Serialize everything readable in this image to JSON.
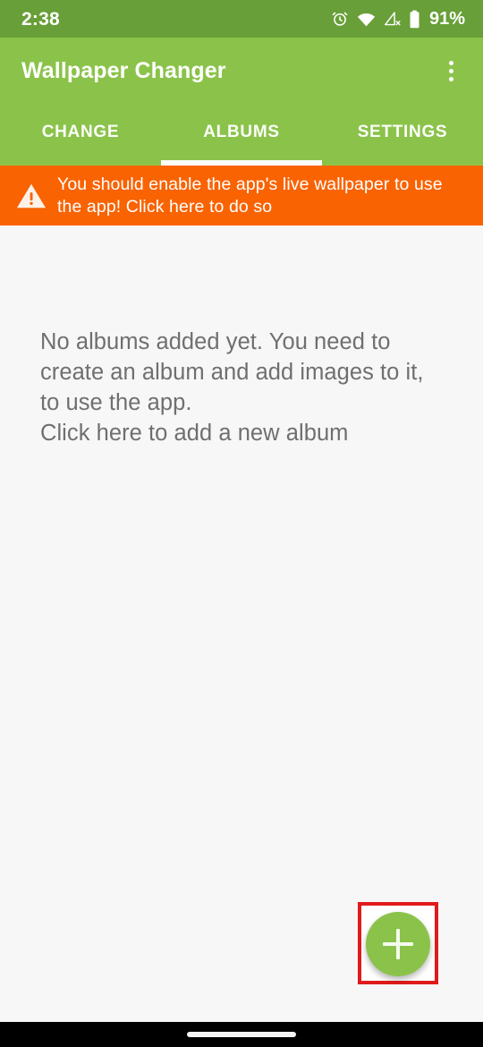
{
  "status_bar": {
    "time": "2:38",
    "battery_percent": "91%",
    "icons": [
      "alarm-icon",
      "wifi-icon",
      "no-sim-signal-icon",
      "battery-icon"
    ],
    "background_color": "#689f38"
  },
  "app_bar": {
    "title": "Wallpaper Changer",
    "overflow_label": "More options",
    "background_color": "#8bc34a"
  },
  "tabs": {
    "items": [
      {
        "label": "CHANGE",
        "selected": false
      },
      {
        "label": "ALBUMS",
        "selected": true
      },
      {
        "label": "SETTINGS",
        "selected": false
      }
    ],
    "indicator_color": "#ffffff"
  },
  "warning_banner": {
    "icon": "warning-triangle-icon",
    "text": "You should enable the app's live wallpaper to use the app! Click here to do so",
    "background_color": "#f96302",
    "text_color": "#ffffff"
  },
  "content": {
    "empty_state_text": "No albums added yet. You need to create an album and add images to it, to use the app.\nClick here to add a new album",
    "text_color": "#6f6f6f",
    "background_color": "#f7f7f7"
  },
  "fab": {
    "icon": "plus-icon",
    "label": "Add album",
    "color": "#8bc34a",
    "highlight_color": "#e01b1b"
  },
  "nav_bar": {
    "type": "gesture-pill",
    "background_color": "#000000",
    "pill_color": "#f4f4f4"
  }
}
